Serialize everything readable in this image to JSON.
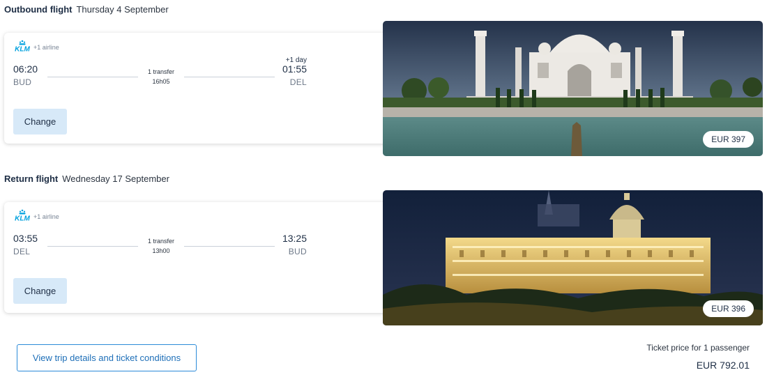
{
  "outbound": {
    "label": "Outbound flight",
    "date": "Thursday 4 September",
    "airline_logo": "KLM",
    "airline_extra": "+1 airline",
    "departure_time": "06:20",
    "departure_code": "BUD",
    "arrival_time": "01:55",
    "arrival_code": "DEL",
    "plus_day": "+1 day",
    "transfers": "1 transfer",
    "duration": "16h05",
    "change_label": "Change",
    "price": "EUR 397",
    "image_icon": "taj-mahal-photo"
  },
  "return": {
    "label": "Return flight",
    "date": "Wednesday 17 September",
    "airline_logo": "KLM",
    "airline_extra": "+1 airline",
    "departure_time": "03:55",
    "departure_code": "DEL",
    "arrival_time": "13:25",
    "arrival_code": "BUD",
    "transfers": "1 transfer",
    "duration": "13h00",
    "change_label": "Change",
    "price": "EUR 396",
    "image_icon": "buda-castle-night-photo"
  },
  "footer": {
    "details_button": "View trip details and ticket conditions",
    "ticket_price_label": "Ticket price for 1 passenger",
    "total_price": "EUR 792.01"
  },
  "colors": {
    "klm_blue": "#00a1de",
    "accent_blue": "#1e6fb8",
    "button_bg": "#d7e9f8"
  }
}
